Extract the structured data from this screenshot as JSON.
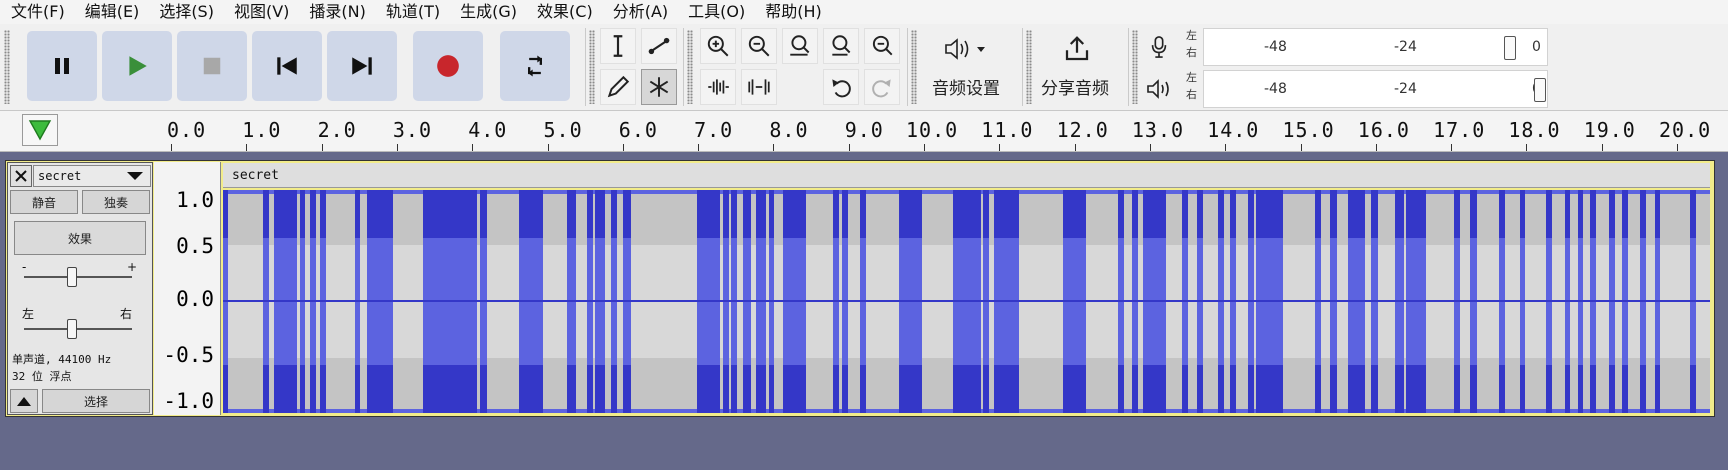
{
  "menu": [
    "文件(F)",
    "编辑(E)",
    "选择(S)",
    "视图(V)",
    "播录(N)",
    "轨道(T)",
    "生成(G)",
    "效果(C)",
    "分析(A)",
    "工具(O)",
    "帮助(H)"
  ],
  "toolbar": {
    "audio_setup_label": "音频设置",
    "share_audio_label": "分享音频"
  },
  "meters": {
    "record": {
      "left": "左",
      "right": "右",
      "ticks": [
        "-48",
        "-24",
        "0"
      ]
    },
    "playback": {
      "left": "左",
      "right": "右",
      "ticks": [
        "-48",
        "-24",
        "0"
      ]
    }
  },
  "timeline": {
    "labels": [
      "0.0",
      "1.0",
      "2.0",
      "3.0",
      "4.0",
      "5.0",
      "6.0",
      "7.0",
      "8.0",
      "9.0",
      "10.0",
      "11.0",
      "12.0",
      "13.0",
      "14.0",
      "15.0",
      "16.0",
      "17.0",
      "18.0",
      "19.0",
      "20.0"
    ]
  },
  "track": {
    "name": "secret",
    "mute_label": "静音",
    "solo_label": "独奏",
    "effects_label": "效果",
    "gain_minus": "-",
    "gain_plus": "+",
    "pan_left": "左",
    "pan_right": "右",
    "info_line1": "单声道, 44100 Hz",
    "info_line2": "32 位 浮点",
    "select_label": "选择",
    "clip_name": "secret",
    "amplitude_labels": [
      "1.0",
      "0.5",
      "0.0",
      "-0.5",
      "-1.0"
    ]
  },
  "colors": {
    "waveform": "#5c63e0",
    "waveform_dark": "#3437c8",
    "record_button": "#c8262c",
    "play_button": "#3a8f3a",
    "selection_border": "#f2ec8a"
  }
}
